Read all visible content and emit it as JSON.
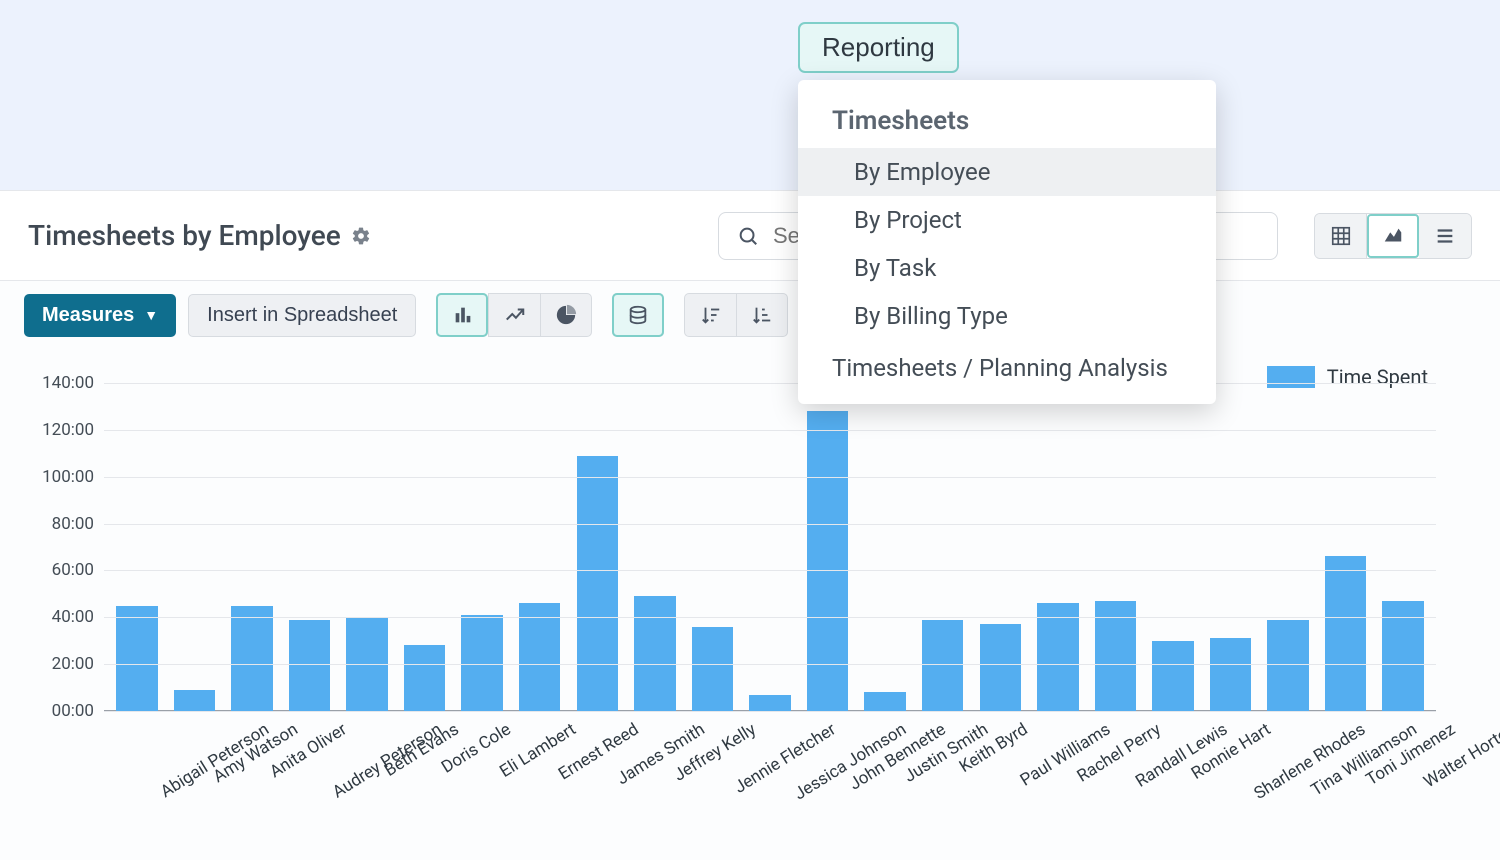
{
  "nav": {
    "reporting_label": "Reporting",
    "dropdown": {
      "section_title": "Timesheets",
      "items": [
        {
          "label": "By Employee",
          "selected": true
        },
        {
          "label": "By Project",
          "selected": false
        },
        {
          "label": "By Task",
          "selected": false
        },
        {
          "label": "By Billing Type",
          "selected": false
        }
      ],
      "bottom_link": "Timesheets / Planning Analysis"
    }
  },
  "header": {
    "title": "Timesheets by Employee",
    "search_placeholder": "Search..."
  },
  "controls": {
    "measures_label": "Measures",
    "insert_spreadsheet_label": "Insert in Spreadsheet"
  },
  "legend": {
    "label": "Time Spent",
    "color": "#54aef0"
  },
  "chart_data": {
    "type": "bar",
    "title": "Timesheets by Employee",
    "xlabel": "",
    "ylabel": "",
    "ylim": [
      0,
      140
    ],
    "y_ticks": [
      "00:00",
      "20:00",
      "40:00",
      "60:00",
      "80:00",
      "100:00",
      "120:00",
      "140:00"
    ],
    "categories": [
      "Abigail Peterson",
      "Amy Watson",
      "Anita Oliver",
      "Audrey Peterson",
      "Beth Evans",
      "Doris Cole",
      "Eli Lambert",
      "Ernest Reed",
      "James Smith",
      "Jeffrey Kelly",
      "Jennie Fletcher",
      "Jessica Johnson",
      "John Bennette",
      "Justin Smith",
      "Keith Byrd",
      "Paul Williams",
      "Rachel Perry",
      "Randall Lewis",
      "Ronnie Hart",
      "Sharlene Rhodes",
      "Tina Williamson",
      "Toni Jimenez",
      "Walter Horton"
    ],
    "series": [
      {
        "name": "Time Spent",
        "values": [
          45,
          9,
          45,
          39,
          40,
          28,
          41,
          46,
          109,
          49,
          36,
          7,
          128,
          8,
          39,
          37,
          46,
          47,
          30,
          31,
          39,
          66,
          47
        ]
      }
    ]
  }
}
